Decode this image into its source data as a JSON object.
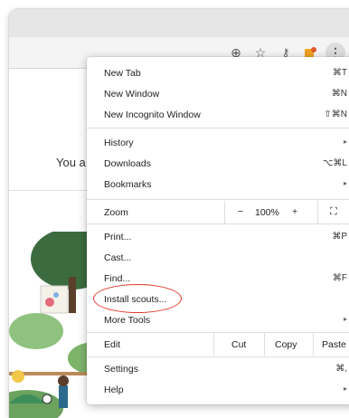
{
  "toolbar": {
    "icons": [
      "add-circle-icon",
      "star-icon",
      "key-icon",
      "puzzle-extension-icon",
      "more-vert-icon"
    ]
  },
  "page": {
    "partial_text": "You a"
  },
  "menu": {
    "items": [
      {
        "label": "New Tab",
        "shortcut": "⌘T"
      },
      {
        "label": "New Window",
        "shortcut": "⌘N"
      },
      {
        "label": "New Incognito Window",
        "shortcut": "⇧⌘N"
      },
      {
        "label": "History",
        "arrow": "▸"
      },
      {
        "label": "Downloads",
        "shortcut": "⌥⌘L"
      },
      {
        "label": "Bookmarks",
        "arrow": "▸"
      },
      {
        "label": "Print...",
        "shortcut": "⌘P"
      },
      {
        "label": "Cast..."
      },
      {
        "label": "Find...",
        "shortcut": "⌘F"
      },
      {
        "label": "Install scouts..."
      },
      {
        "label": "More Tools",
        "arrow": "▸"
      },
      {
        "label": "Settings",
        "shortcut": "⌘,"
      },
      {
        "label": "Help",
        "arrow": "▸"
      }
    ],
    "zoom": {
      "label": "Zoom",
      "minus": "−",
      "level": "100%",
      "plus": "+",
      "fullscreen": "⛶"
    },
    "edit": {
      "label": "Edit",
      "cut": "Cut",
      "copy": "Copy",
      "paste": "Paste"
    }
  },
  "colors": {
    "highlight": "#e03b2c",
    "extension_icon": "#f0a020"
  }
}
